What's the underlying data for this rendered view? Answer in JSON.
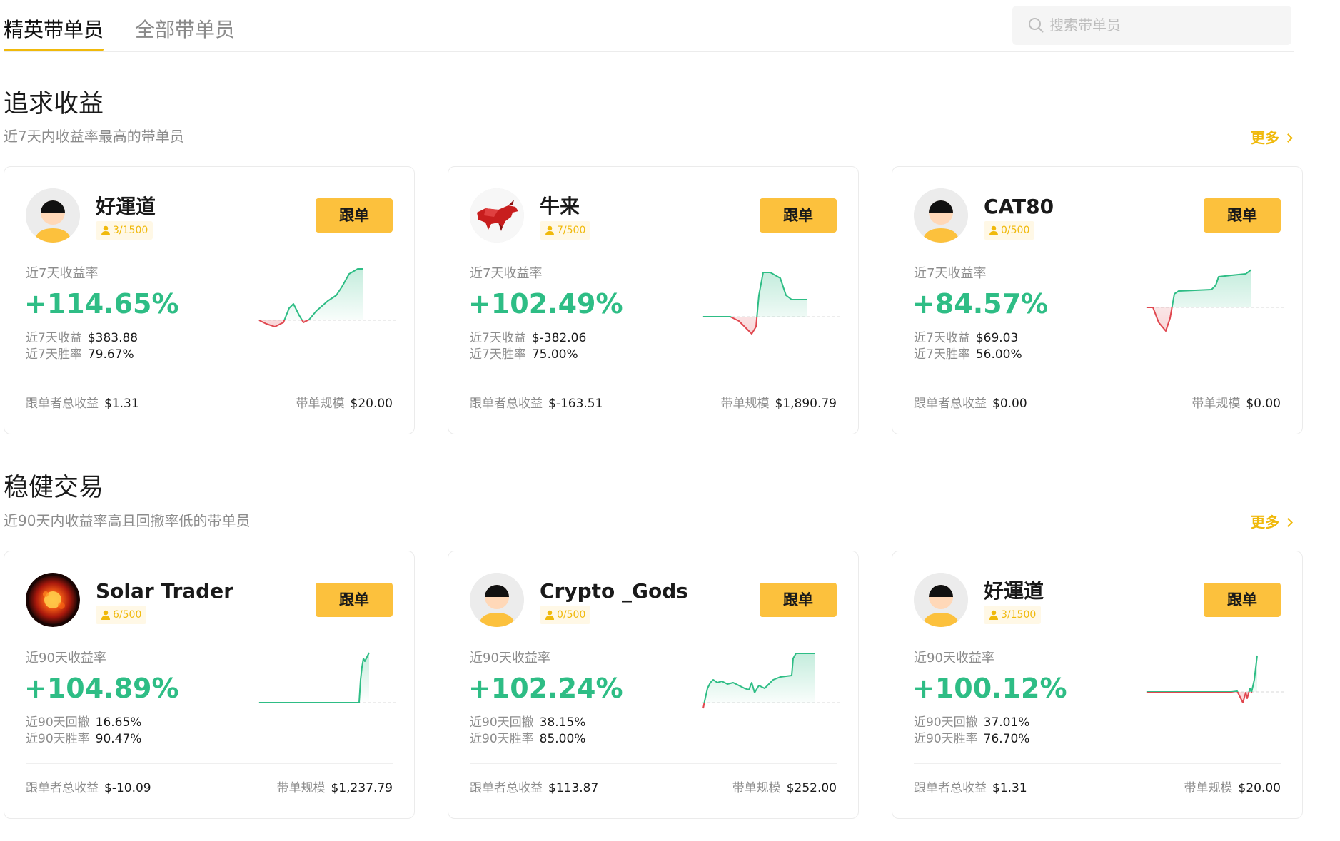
{
  "tabs": {
    "elite": "精英带单员",
    "all": "全部带单员"
  },
  "search": {
    "placeholder": "搜索带单员"
  },
  "sections": [
    {
      "title": "追求收益",
      "subtitle": "近7天内收益率最高的带单员",
      "more": "更多",
      "cards": [
        {
          "name": "好運道",
          "avatar": "default-avatar",
          "followers": "3/1500",
          "follow_label": "跟单",
          "metric_label": "近7天收益率",
          "metric_value": "+114.65%",
          "row1_label": "近7天收益",
          "row1_value": "$383.88",
          "row2_label": "近7天胜率",
          "row2_value": "79.67%",
          "foot_left_label": "跟单者总收益",
          "foot_left_value": "$1.31",
          "foot_right_label": "带单规模",
          "foot_right_value": "$20.00"
        },
        {
          "name": "牛来",
          "avatar": "bull-avatar",
          "followers": "7/500",
          "follow_label": "跟单",
          "metric_label": "近7天收益率",
          "metric_value": "+102.49%",
          "row1_label": "近7天收益",
          "row1_value": "$-382.06",
          "row2_label": "近7天胜率",
          "row2_value": "75.00%",
          "foot_left_label": "跟单者总收益",
          "foot_left_value": "$-163.51",
          "foot_right_label": "带单规模",
          "foot_right_value": "$1,890.79"
        },
        {
          "name": "CAT80",
          "avatar": "default-avatar",
          "followers": "0/500",
          "follow_label": "跟单",
          "metric_label": "近7天收益率",
          "metric_value": "+84.57%",
          "row1_label": "近7天收益",
          "row1_value": "$69.03",
          "row2_label": "近7天胜率",
          "row2_value": "56.00%",
          "foot_left_label": "跟单者总收益",
          "foot_left_value": "$0.00",
          "foot_right_label": "带单规模",
          "foot_right_value": "$0.00"
        }
      ]
    },
    {
      "title": "稳健交易",
      "subtitle": "近90天内收益率高且回撤率低的带单员",
      "more": "更多",
      "cards": [
        {
          "name": "Solar Trader",
          "avatar": "sun-avatar",
          "followers": "6/500",
          "follow_label": "跟单",
          "metric_label": "近90天收益率",
          "metric_value": "+104.89%",
          "row1_label": "近90天回撤",
          "row1_value": "16.65%",
          "row2_label": "近90天胜率",
          "row2_value": "90.47%",
          "foot_left_label": "跟单者总收益",
          "foot_left_value": "$-10.09",
          "foot_right_label": "带单规模",
          "foot_right_value": "$1,237.79"
        },
        {
          "name": "Crypto _Gods",
          "avatar": "default-avatar",
          "followers": "0/500",
          "follow_label": "跟单",
          "metric_label": "近90天收益率",
          "metric_value": "+102.24%",
          "row1_label": "近90天回撤",
          "row1_value": "38.15%",
          "row2_label": "近90天胜率",
          "row2_value": "85.00%",
          "foot_left_label": "跟单者总收益",
          "foot_left_value": "$113.87",
          "foot_right_label": "带单规模",
          "foot_right_value": "$252.00"
        },
        {
          "name": "好運道",
          "avatar": "default-avatar",
          "followers": "3/1500",
          "follow_label": "跟单",
          "metric_label": "近90天收益率",
          "metric_value": "+100.12%",
          "row1_label": "近90天回撤",
          "row1_value": "37.01%",
          "row2_label": "近90天胜率",
          "row2_value": "76.70%",
          "foot_left_label": "跟单者总收益",
          "foot_left_value": "$1.31",
          "foot_right_label": "带单规模",
          "foot_right_value": "$20.00"
        }
      ]
    }
  ],
  "colors": {
    "accent": "#f0b90b",
    "button": "#fcc13d",
    "positive": "#2ebd85",
    "negative": "#e0474f"
  }
}
